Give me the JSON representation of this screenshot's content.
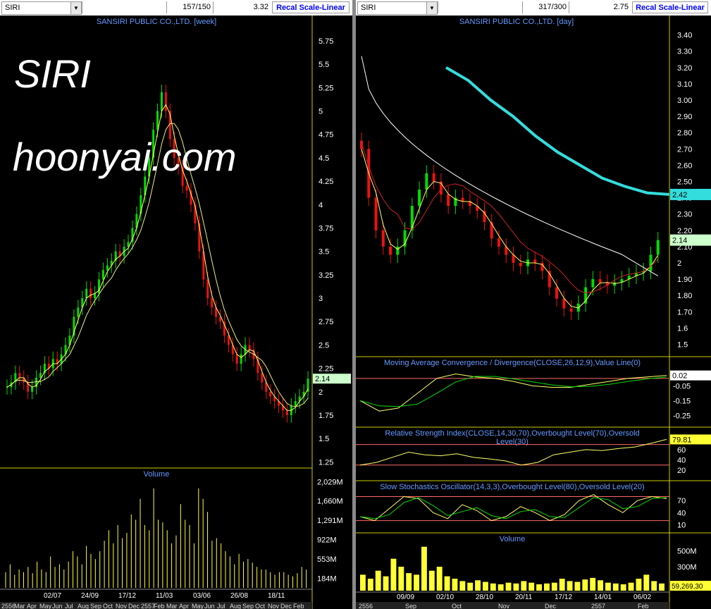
{
  "left": {
    "symbol": "SIRI",
    "count": "157/150",
    "price": "3.32",
    "recal_label": "Recal Scale-Linear",
    "title": "SANSIRI PUBLIC CO.,LTD. [week]",
    "overlay_line1": "SIRI",
    "overlay_line2": "hoonyai.com",
    "price_ticks": [
      "5.75",
      "5.5",
      "5.25",
      "5",
      "4.75",
      "4.5",
      "4.25",
      "4",
      "3.75",
      "3.5",
      "3.25",
      "3",
      "2.75",
      "2.5",
      "2.25",
      "2",
      "1.75",
      "1.5",
      "1.25"
    ],
    "last_price": "2.14",
    "volume_title": "Volume",
    "volume_ticks": [
      "2,029M",
      "1,660M",
      "1,291M",
      "922M",
      "553M",
      "184M"
    ],
    "date_labels": [
      "02/07",
      "24/09",
      "17/12",
      "11/03",
      "03/06",
      "26/08",
      "18/11"
    ],
    "bottom_labels": [
      "2556",
      "Mar",
      "Apr",
      "May",
      "Jun",
      "Jul",
      "Aug",
      "Sep",
      "Oct",
      "Nov",
      "Dec",
      "2557",
      "Feb",
      "Mar",
      "Apr",
      "May",
      "Jun",
      "Jul",
      "Aug",
      "Sep",
      "Oct",
      "Nov",
      "Dec",
      "Feb"
    ]
  },
  "right": {
    "symbol": "SIRI",
    "count": "317/300",
    "price": "2.75",
    "recal_label": "Recal Scale-Linear",
    "title": "SANSIRI PUBLIC CO.,LTD. [day]",
    "price_ticks": [
      "3.40",
      "3.30",
      "3.20",
      "3.10",
      "3.00",
      "2.90",
      "2.80",
      "2.70",
      "2.60",
      "2.50",
      "2.40",
      "2.30",
      "2.20",
      "2.10",
      "2",
      "1.90",
      "1.80",
      "1.70",
      "1.6",
      "1.5"
    ],
    "ma_label": "2.42",
    "last_price": "2.14",
    "macd_title": "Moving Average Convergence / Divergence(CLOSE,26,12,9),Value Line(0)",
    "macd_ticks": [
      "-0.05",
      "-0.15",
      "-0.25"
    ],
    "macd_value": "0.02",
    "rsi_title_1": "Relative Strength Index(CLOSE,14,30,70),Overbought Level(70),Oversold",
    "rsi_title_2": "Level(30)",
    "rsi_ticks": [
      "80",
      "60",
      "40",
      "20"
    ],
    "rsi_value": "79.81",
    "stoch_title": "Slow Stochastics Oscillator(14,3,3),Overbought Level(80),Oversold Level(20)",
    "stoch_ticks": [
      "70",
      "40",
      "10"
    ],
    "volume_title": "Volume",
    "volume_ticks": [
      "500M",
      "300M"
    ],
    "volume_value": "59,269,30",
    "date_labels": [
      "09/09",
      "02/10",
      "28/10",
      "20/11",
      "17/12",
      "14/01",
      "06/02"
    ],
    "bottom_labels": [
      "2556",
      "Sep",
      "Oct",
      "Nov",
      "Dec",
      "2557",
      "Feb"
    ]
  },
  "colors": {
    "up": "#00dd00",
    "down": "#ee1111",
    "ma_fast": "#ffff66",
    "ma_mid": "#cc2222",
    "ma_slow": "#ffffff",
    "ma_long": "#33dddd",
    "volume": "#ffff33",
    "level_line": "#ff6666",
    "panel_border": "#cccc00",
    "title_text": "#6699ff"
  },
  "chart_data": [
    {
      "type": "candlestick",
      "title": "SANSIRI PUBLIC CO.,LTD. [week]",
      "ylim": [
        1.2,
        5.9
      ],
      "close": [
        2.05,
        2.1,
        2.2,
        2.15,
        2.1,
        2.0,
        2.05,
        2.15,
        2.2,
        2.3,
        2.25,
        2.35,
        2.3,
        2.4,
        2.5,
        2.6,
        2.8,
        2.9,
        3.0,
        3.1,
        3.0,
        3.05,
        3.2,
        3.3,
        3.35,
        3.4,
        3.5,
        3.45,
        3.55,
        3.6,
        3.75,
        3.9,
        4.1,
        4.3,
        4.5,
        4.8,
        5.0,
        5.2,
        5.0,
        4.7,
        4.5,
        4.4,
        4.2,
        4.15,
        4.0,
        3.8,
        3.5,
        3.2,
        3.0,
        2.9,
        2.8,
        2.75,
        2.6,
        2.5,
        2.4,
        2.3,
        2.4,
        2.5,
        2.45,
        2.35,
        2.2,
        2.1,
        2.0,
        1.95,
        1.9,
        1.85,
        1.8,
        1.75,
        1.85,
        1.9,
        1.95,
        2.0,
        2.14
      ],
      "volume_millions": [
        300,
        450,
        250,
        350,
        300,
        400,
        280,
        500,
        350,
        300,
        600,
        400,
        450,
        350,
        500,
        700,
        600,
        450,
        800,
        650,
        550,
        700,
        900,
        1100,
        850,
        1200,
        950,
        1050,
        1400,
        1300,
        1700,
        1200,
        1100,
        1900,
        1300,
        1250,
        1100,
        850,
        1000,
        1600,
        1300,
        1200,
        850,
        1900,
        1700,
        1450,
        900,
        950,
        850,
        700,
        600,
        450,
        650,
        500,
        550,
        480,
        400,
        350,
        350,
        300,
        250,
        300,
        300,
        250,
        220,
        280,
        400,
        350
      ]
    },
    {
      "type": "candlestick",
      "title": "SANSIRI PUBLIC CO.,LTD. [day]",
      "ylim": [
        1.45,
        3.45
      ],
      "close": [
        2.7,
        2.4,
        2.2,
        2.1,
        2.05,
        2.1,
        2.2,
        2.35,
        2.45,
        2.55,
        2.5,
        2.42,
        2.35,
        2.4,
        2.38,
        2.35,
        2.32,
        2.25,
        2.15,
        2.1,
        2.05,
        2.0,
        1.98,
        2.02,
        2.0,
        1.95,
        1.85,
        1.78,
        1.72,
        1.7,
        1.75,
        1.85,
        1.9,
        1.88,
        1.86,
        1.88,
        1.9,
        1.92,
        1.94,
        1.95,
        2.05,
        2.14
      ],
      "ma_long": [
        3.2,
        3.12,
        3.0,
        2.9,
        2.78,
        2.68,
        2.6,
        2.52,
        2.47,
        2.43,
        2.42
      ],
      "macd": [
        -0.15,
        -0.22,
        -0.2,
        -0.1,
        0.0,
        0.03,
        0.01,
        0.0,
        -0.02,
        -0.05,
        -0.06,
        -0.06,
        -0.04,
        -0.02,
        0.0,
        0.01,
        0.02
      ],
      "rsi": [
        30,
        35,
        45,
        55,
        50,
        48,
        52,
        45,
        42,
        38,
        30,
        35,
        50,
        55,
        60,
        58,
        62,
        65,
        72,
        79.81
      ],
      "stoch": [
        30,
        20,
        50,
        80,
        75,
        40,
        25,
        60,
        45,
        20,
        30,
        55,
        40,
        20,
        35,
        70,
        85,
        60,
        40,
        70,
        80,
        75
      ],
      "volume_millions": [
        200,
        150,
        250,
        180,
        400,
        300,
        220,
        200,
        550,
        250,
        300,
        180,
        150,
        120,
        100,
        130,
        110,
        90,
        80,
        100,
        90,
        120,
        100,
        80,
        90,
        100,
        150,
        120,
        110,
        140,
        160,
        130,
        100,
        90,
        80,
        100,
        150,
        200,
        120,
        90
      ]
    }
  ]
}
